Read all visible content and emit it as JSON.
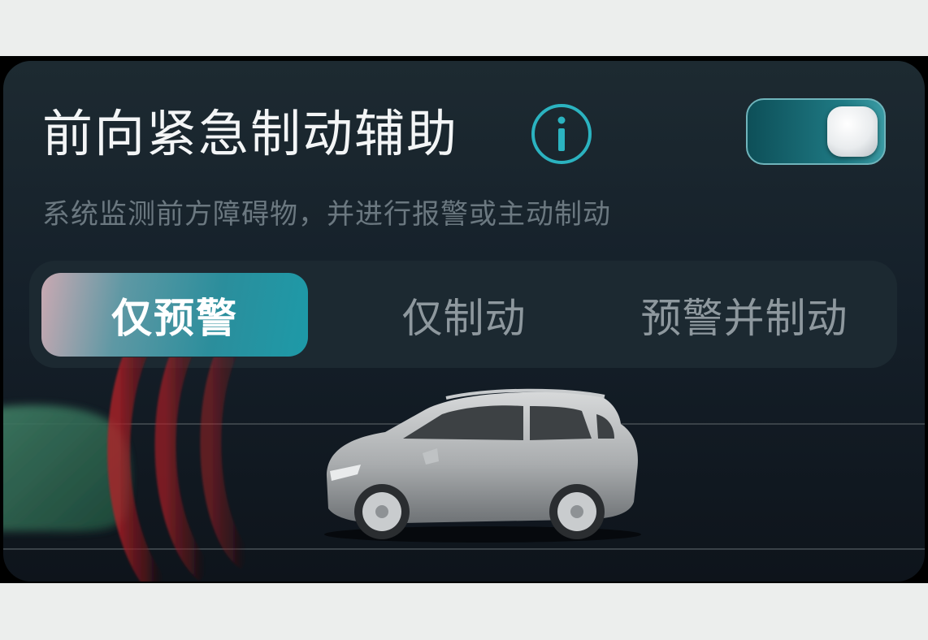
{
  "feature": {
    "title": "前向紧急制动辅助",
    "description": "系统监测前方障碍物，并进行报警或主动制动",
    "enabled": true,
    "info_icon": "info-icon"
  },
  "modes": {
    "selected": "仅预警",
    "options": [
      {
        "label": "仅预警"
      },
      {
        "label": "仅制动"
      },
      {
        "label": "预警并制动"
      }
    ]
  },
  "colors": {
    "accent": "#1d9aa8",
    "warning_wave": "#c0242a",
    "obstacle": "#2e6650"
  }
}
